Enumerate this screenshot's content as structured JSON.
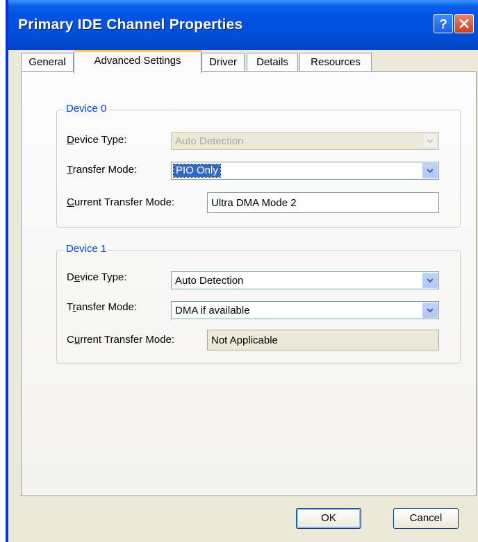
{
  "window": {
    "title": "Primary IDE Channel Properties"
  },
  "tabs": [
    {
      "label": "General"
    },
    {
      "label": "Advanced Settings",
      "active": true
    },
    {
      "label": "Driver"
    },
    {
      "label": "Details"
    },
    {
      "label": "Resources"
    }
  ],
  "device0": {
    "legend": "Device 0",
    "device_type_label": "Device Type:",
    "device_type_value": "Auto Detection",
    "device_type_disabled": true,
    "transfer_mode_label": "Transfer Mode:",
    "transfer_mode_value": "PIO Only",
    "current_mode_label": "Current Transfer Mode:",
    "current_mode_value": "Ultra DMA Mode 2"
  },
  "device1": {
    "legend": "Device 1",
    "device_type_label": "Device Type:",
    "device_type_value": "Auto Detection",
    "transfer_mode_label": "Transfer Mode:",
    "transfer_mode_value": "DMA if available",
    "current_mode_label": "Current Transfer Mode:",
    "current_mode_value": "Not Applicable"
  },
  "buttons": {
    "ok": "OK",
    "cancel": "Cancel"
  },
  "icons": {
    "help": "help-icon",
    "close": "close-icon",
    "dropdown": "chevron-down-icon"
  },
  "colors": {
    "titlebar": "#0054e3",
    "legend_text": "#0046d5",
    "selection": "#316ac5",
    "active_tab_accent": "#ffc83c"
  }
}
